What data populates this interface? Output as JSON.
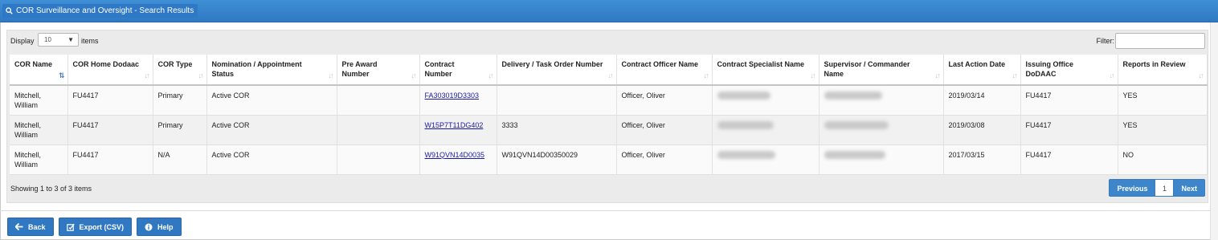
{
  "window": {
    "title": "COR Surveillance and Oversight - Search Results",
    "title_icon": "search-icon"
  },
  "toolbar": {
    "display_label": "Display",
    "page_size": "10",
    "items_label": "items",
    "filter_label": "Filter:",
    "filter_value": ""
  },
  "table": {
    "columns": [
      {
        "label": "COR Name",
        "sorted": true
      },
      {
        "label": "COR Home Dodaac",
        "sorted": false
      },
      {
        "label": "COR Type",
        "sorted": false
      },
      {
        "label": "Nomination / Appointment Status",
        "sorted": false
      },
      {
        "label": "Pre Award Number",
        "sorted": false
      },
      {
        "label": "Contract Number",
        "sorted": false
      },
      {
        "label": "Delivery / Task Order Number",
        "sorted": false
      },
      {
        "label": "Contract Officer Name",
        "sorted": false
      },
      {
        "label": "Contract Specialist Name",
        "sorted": false
      },
      {
        "label": "Supervisor / Commander Name",
        "sorted": false
      },
      {
        "label": "Last Action Date",
        "sorted": false
      },
      {
        "label": "Issuing Office DoDAAC",
        "sorted": false
      },
      {
        "label": "Reports in Review",
        "sorted": false
      }
    ],
    "rows": [
      {
        "cor_name": "Mitchell, William",
        "home_dodaac": "FU4417",
        "cor_type": "Primary",
        "status": "Active COR",
        "pre_award": "",
        "contract_number": "FA303019D3303",
        "delivery_order": "",
        "contract_officer": "Officer, Oliver",
        "last_action": "2019/03/14",
        "issuing_office": "FU4417",
        "reports_review": "YES"
      },
      {
        "cor_name": "Mitchell, William",
        "home_dodaac": "FU4417",
        "cor_type": "Primary",
        "status": "Active COR",
        "pre_award": "",
        "contract_number": "W15P7T11DG402",
        "delivery_order": "3333",
        "contract_officer": "Officer, Oliver",
        "last_action": "2019/03/08",
        "issuing_office": "FU4417",
        "reports_review": "YES"
      },
      {
        "cor_name": "Mitchell, William",
        "home_dodaac": "FU4417",
        "cor_type": "N/A",
        "status": "Active COR",
        "pre_award": "",
        "contract_number": "W91QVN14D0035",
        "delivery_order": "W91QVN14D00350029",
        "contract_officer": "Officer, Oliver",
        "last_action": "2017/03/15",
        "issuing_office": "FU4417",
        "reports_review": "NO"
      }
    ]
  },
  "footer": {
    "info": "Showing 1 to 3 of 3 items",
    "previous_label": "Previous",
    "current_page": "1",
    "next_label": "Next"
  },
  "actions": {
    "back_label": "Back",
    "export_label": "Export (CSV)",
    "help_label": "Help"
  },
  "colors": {
    "header_blue": "#2f79c2",
    "button_blue": "#3178c3",
    "link": "#1a1aa6"
  }
}
